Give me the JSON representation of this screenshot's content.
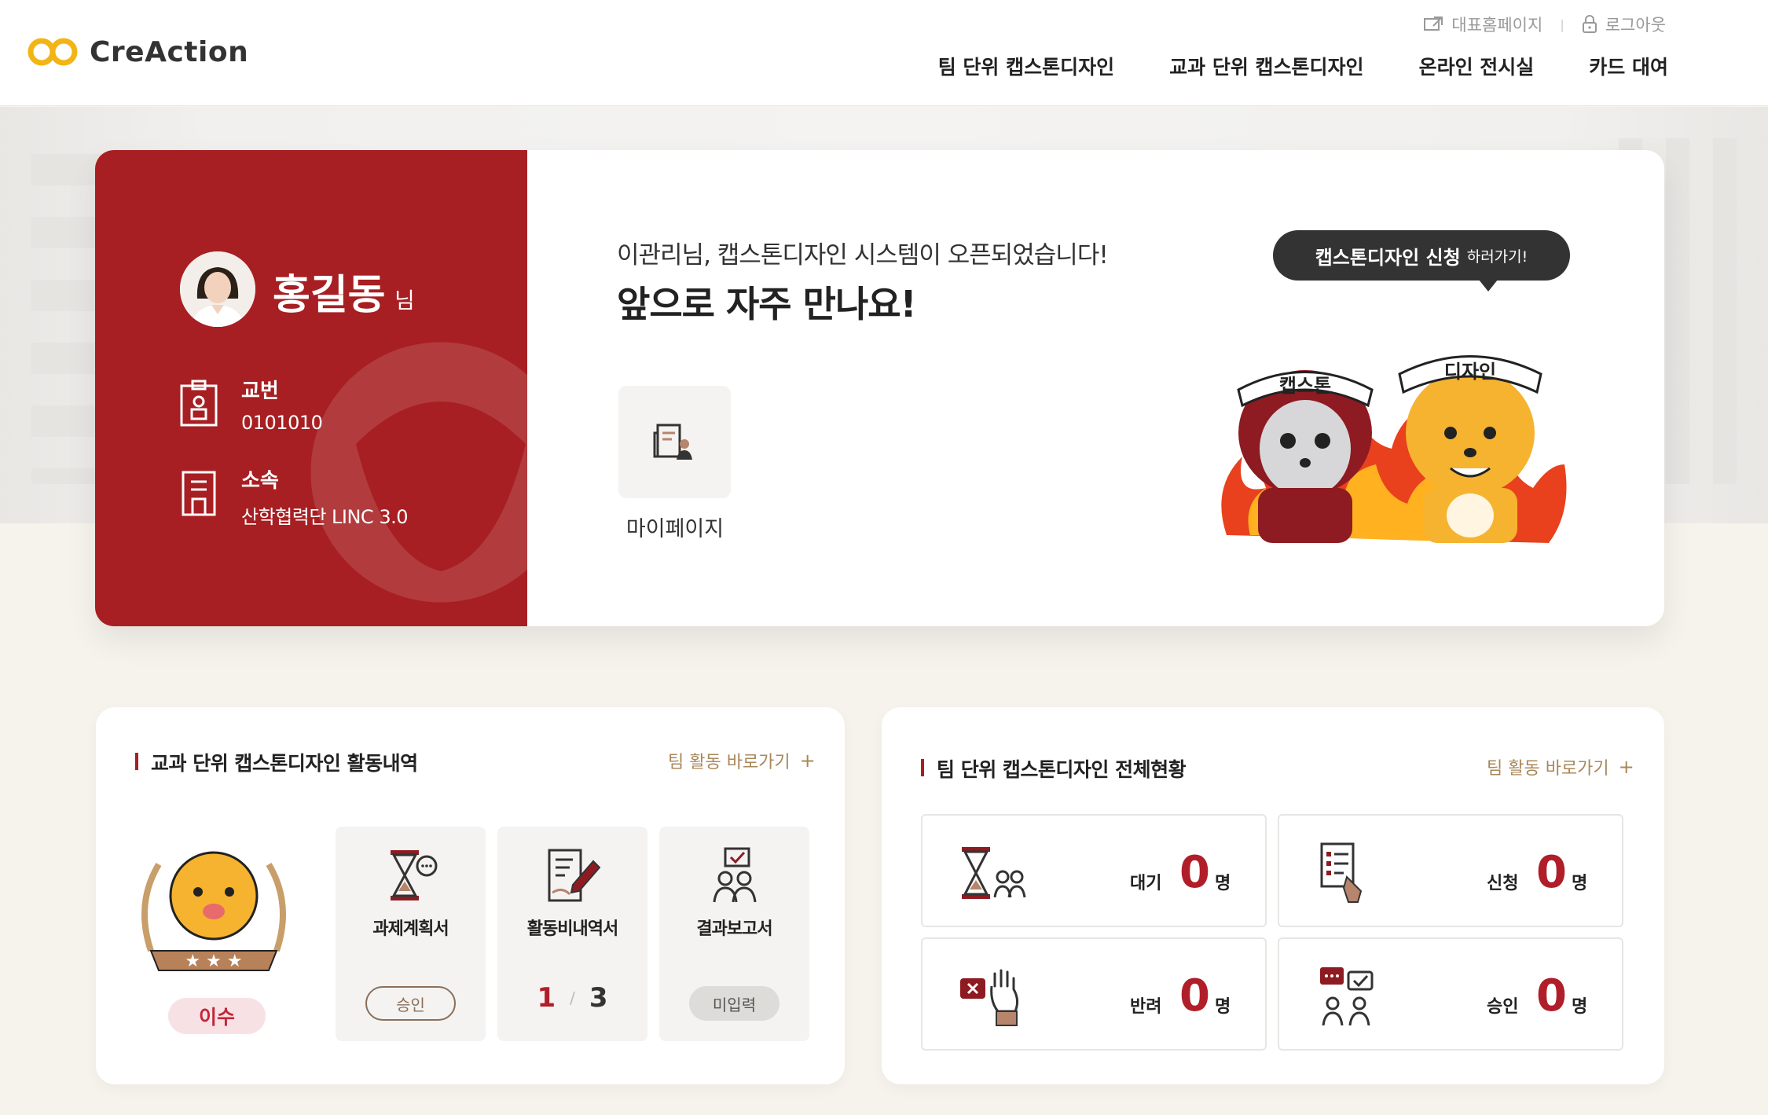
{
  "brand": {
    "name": "CreAction",
    "accent": "#a71f22",
    "logo_color": "#f2b516"
  },
  "util_links": [
    {
      "icon": "external-link-icon",
      "label": "대표홈페이지"
    },
    {
      "icon": "lock-icon",
      "label": "로그아웃"
    }
  ],
  "nav": {
    "items": [
      "팀 단위 캡스톤디자인",
      "교과 단위 캡스톤디자인",
      "온라인 전시실",
      "카드 대여"
    ]
  },
  "profile": {
    "name": "홍길동",
    "suffix": "님",
    "id_label": "교번",
    "id_value": "0101010",
    "dept_label": "소속",
    "dept_value": "산학협력단 LINC 3.0"
  },
  "welcome": {
    "sub": "이관리님, 캡스톤디자인 시스템이 오픈되었습니다!",
    "main": "앞으로 자주 만나요!"
  },
  "mypage": {
    "label": "마이페이지"
  },
  "apply": {
    "strong": "캡스톤디자인 신청",
    "rest": "하러가기!"
  },
  "mascots": {
    "left_band": "캡스톤",
    "right_band": "디자인"
  },
  "course_card": {
    "title": "교과 단위 캡스톤디자인 활동내역",
    "link": "팀 활동 바로가기",
    "link_icon": "plus",
    "status": "이수",
    "docs": [
      {
        "label": "과제계획서",
        "status": "승인"
      },
      {
        "label": "활동비내역서",
        "done": "1",
        "total": "3"
      },
      {
        "label": "결과보고서",
        "status": "미입력"
      }
    ]
  },
  "team_card": {
    "title": "팀 단위 캡스톤디자인 전체현황",
    "link": "팀 활동 바로가기",
    "link_icon": "plus",
    "stats": [
      {
        "label": "대기",
        "value": "0",
        "unit": "명"
      },
      {
        "label": "신청",
        "value": "0",
        "unit": "명"
      },
      {
        "label": "반려",
        "value": "0",
        "unit": "명"
      },
      {
        "label": "승인",
        "value": "0",
        "unit": "명"
      }
    ]
  }
}
